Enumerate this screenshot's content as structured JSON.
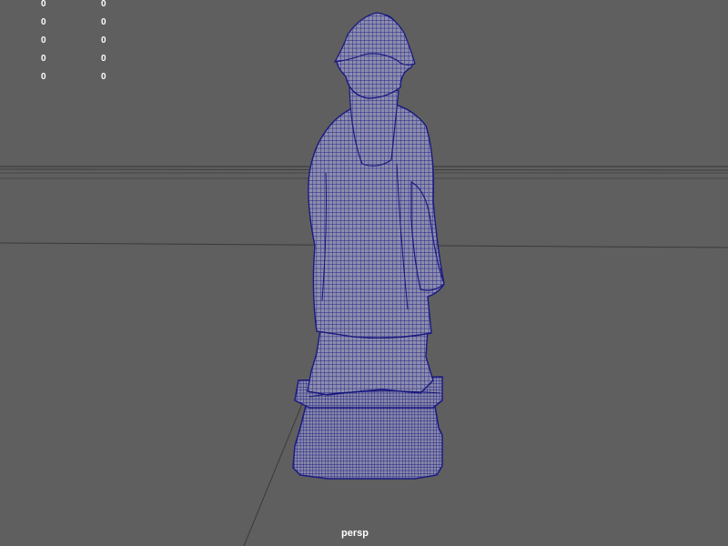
{
  "viewport": {
    "camera_label": "persp",
    "background_color": "#5f5f5f",
    "wireframe_color": "#1e1e86",
    "mesh_fill_color": "#8a8aa8",
    "grid_line_color": "#3a3a3a"
  },
  "hud": {
    "rows": [
      {
        "a": "0",
        "b": "0"
      },
      {
        "a": "0",
        "b": "0"
      },
      {
        "a": "0",
        "b": "0"
      },
      {
        "a": "0",
        "b": "0"
      },
      {
        "a": "0",
        "b": "0"
      }
    ]
  }
}
